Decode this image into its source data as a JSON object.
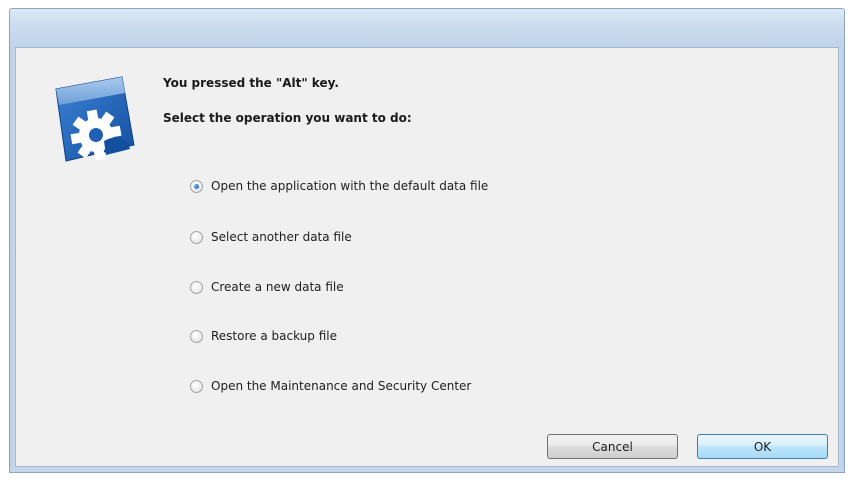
{
  "dialog": {
    "heading": "You pressed the \"Alt\" key.",
    "instruction": "Select the operation you want to do:",
    "options": [
      {
        "label": "Open the application with the default data file",
        "checked": true
      },
      {
        "label": "Select another data file",
        "checked": false
      },
      {
        "label": "Create a new data file",
        "checked": false
      },
      {
        "label": "Restore a backup file",
        "checked": false
      },
      {
        "label": "Open the Maintenance and Security Center",
        "checked": false
      }
    ],
    "buttons": {
      "cancel": "Cancel",
      "ok": "OK"
    }
  },
  "icon": {
    "name": "settings-gear-icon",
    "colors": {
      "blue": "#1f5fb4",
      "light_blue": "#8fb8e6",
      "white": "#ffffff"
    }
  },
  "colors": {
    "titlebar": "#cbdcee",
    "client_background": "#f0f0f0",
    "radio_selected": "#2a6fc4"
  }
}
